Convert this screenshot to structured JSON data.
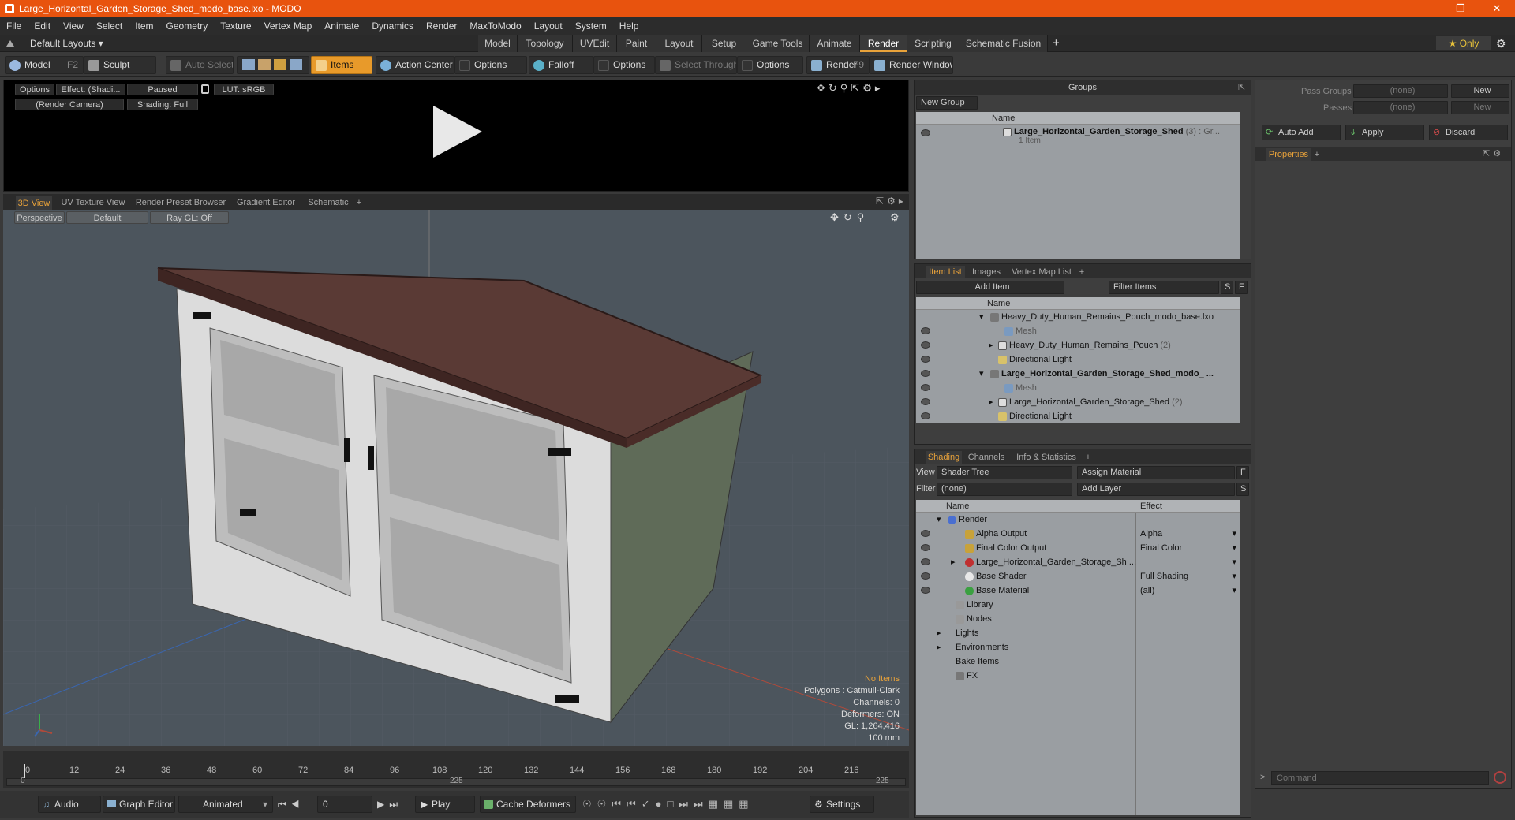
{
  "window": {
    "title": "Large_Horizontal_Garden_Storage_Shed_modo_base.lxo - MODO"
  },
  "menu": [
    "File",
    "Edit",
    "View",
    "Select",
    "Item",
    "Geometry",
    "Texture",
    "Vertex Map",
    "Animate",
    "Dynamics",
    "Render",
    "MaxToModo",
    "Layout",
    "System",
    "Help"
  ],
  "layout": {
    "preset": "Default Layouts ▾",
    "tabs": [
      "Model",
      "Topology",
      "UVEdit",
      "Paint",
      "Layout",
      "Setup",
      "Game Tools",
      "Animate",
      "Render",
      "Scripting",
      "Schematic Fusion"
    ],
    "active_tab": "Render",
    "add": "+",
    "only": "★ Only"
  },
  "toolbar": {
    "model": "Model",
    "model_key": "F2",
    "sculpt": "Sculpt",
    "auto_select": "Auto Select",
    "items": "Items",
    "action_center": "Action Center",
    "options1": "Options",
    "falloff": "Falloff",
    "options2": "Options",
    "select_through": "Select Through",
    "options3": "Options",
    "render": "Render",
    "render_key": "F9",
    "render_window": "Render Window"
  },
  "preview": {
    "options": "Options",
    "effect": "Effect: (Shadi...",
    "paused": "Paused",
    "lut": "LUT: sRGB",
    "camera": "(Render Camera)",
    "shading": "Shading: Full"
  },
  "viewport_tabs": [
    "3D View",
    "UV Texture View",
    "Render Preset Browser",
    "Gradient Editor",
    "Schematic",
    "+"
  ],
  "viewport": {
    "perspective": "Perspective",
    "default": "Default",
    "raygl": "Ray GL: Off",
    "stats": {
      "no_items": "No Items",
      "polygons": "Polygons : Catmull-Clark",
      "channels": "Channels: 0",
      "deformers": "Deformers: ON",
      "gl": "GL: 1,264,416",
      "unit": "100 mm"
    }
  },
  "timeline": {
    "ticks": [
      "0",
      "12",
      "24",
      "36",
      "48",
      "60",
      "72",
      "84",
      "96",
      "108",
      "120",
      "132",
      "144",
      "156",
      "168",
      "180",
      "192",
      "204",
      "216"
    ],
    "start": "0",
    "end": "225",
    "mid": "225"
  },
  "bottombar": {
    "audio": "Audio",
    "graph_editor": "Graph Editor",
    "animated": "Animated",
    "frame": "0",
    "play": "Play",
    "cache_deformers": "Cache Deformers",
    "settings": "Settings"
  },
  "groups": {
    "header": "Groups",
    "new_group": "New Group",
    "name_col": "Name",
    "item_name": "Large_Horizontal_Garden_Storage_Shed",
    "item_suffix": "(3) : Gr...",
    "item_count": "1 Item"
  },
  "pass": {
    "pass_groups": "Pass Groups",
    "passes": "Passes",
    "none1": "(none)",
    "none2": "(none)",
    "new1": "New",
    "new2": "New",
    "auto_add": "Auto Add",
    "apply": "Apply",
    "discard": "Discard",
    "properties": "Properties",
    "add": "+"
  },
  "itemlist": {
    "tabs": [
      "Item List",
      "Images",
      "Vertex Map List",
      "+"
    ],
    "add_item": "Add Item",
    "filter": "Filter Items",
    "s": "S",
    "f": "F",
    "name_col": "Name",
    "rows": [
      {
        "label": "Heavy_Duty_Human_Remains_Pouch_modo_base.lxo",
        "indent": 0,
        "style": "normal",
        "count": ""
      },
      {
        "label": "Mesh",
        "indent": 2,
        "style": "gray",
        "count": ""
      },
      {
        "label": "Heavy_Duty_Human_Remains_Pouch",
        "indent": 1,
        "style": "normal",
        "count": "(2)"
      },
      {
        "label": "Directional Light",
        "indent": 1,
        "style": "normal",
        "count": ""
      },
      {
        "label": "Large_Horizontal_Garden_Storage_Shed_modo_ ...",
        "indent": 0,
        "style": "bold",
        "count": ""
      },
      {
        "label": "Mesh",
        "indent": 2,
        "style": "gray",
        "count": ""
      },
      {
        "label": "Large_Horizontal_Garden_Storage_Shed",
        "indent": 1,
        "style": "normal",
        "count": "(2)"
      },
      {
        "label": "Directional Light",
        "indent": 1,
        "style": "normal",
        "count": ""
      }
    ]
  },
  "shading": {
    "tabs": [
      "Shading",
      "Channels",
      "Info & Statistics",
      "+"
    ],
    "view_label": "View",
    "view_value": "Shader Tree",
    "assign_material": "Assign Material",
    "filter_label": "Filter",
    "filter_value": "(none)",
    "add_layer": "Add Layer",
    "f": "F",
    "s": "S",
    "name_col": "Name",
    "effect_col": "Effect",
    "rows": [
      {
        "label": "Render",
        "effect": "",
        "indent": 0,
        "icon": "#4a6fd0"
      },
      {
        "label": "Alpha Output",
        "effect": "Alpha",
        "indent": 1,
        "icon": "#c8a23a"
      },
      {
        "label": "Final Color Output",
        "effect": "Final Color",
        "indent": 1,
        "icon": "#c8a23a"
      },
      {
        "label": "Large_Horizontal_Garden_Storage_Sh ...",
        "effect": "",
        "indent": 1,
        "icon": "#c03030"
      },
      {
        "label": "Base Shader",
        "effect": "Full Shading",
        "indent": 1,
        "icon": "#dddddd"
      },
      {
        "label": "Base Material",
        "effect": "(all)",
        "indent": 1,
        "icon": "#3aa040"
      },
      {
        "label": "Library",
        "effect": "",
        "indent": 0,
        "icon": ""
      },
      {
        "label": "Nodes",
        "effect": "",
        "indent": 0,
        "icon": ""
      },
      {
        "label": "Lights",
        "effect": "",
        "indent": -1,
        "icon": ""
      },
      {
        "label": "Environments",
        "effect": "",
        "indent": -1,
        "icon": ""
      },
      {
        "label": "Bake Items",
        "effect": "",
        "indent": -1,
        "icon": ""
      },
      {
        "label": "FX",
        "effect": "",
        "indent": 0,
        "icon": ""
      }
    ]
  },
  "command": {
    "placeholder": "Command",
    "prompt": ">"
  }
}
